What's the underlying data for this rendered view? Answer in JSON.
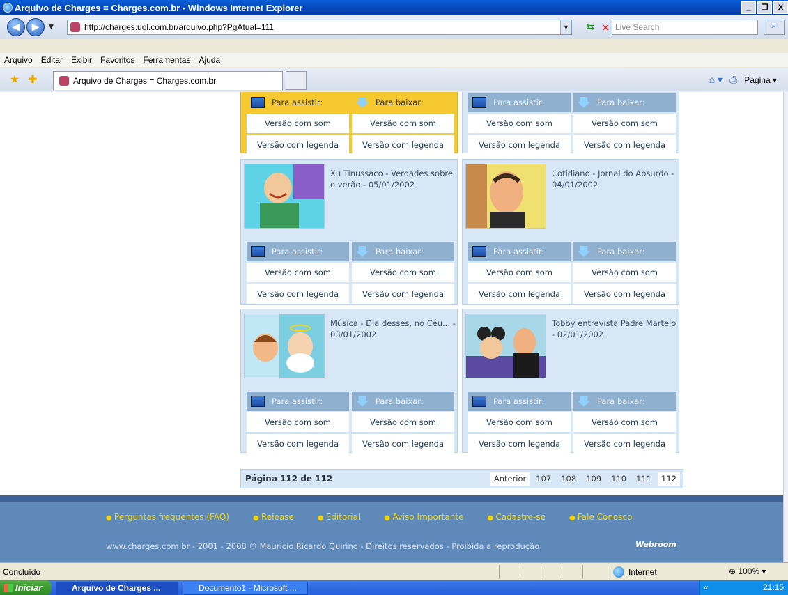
{
  "window": {
    "title": "Arquivo de Charges = Charges.com.br - Windows Internet Explorer",
    "controls": [
      "_",
      "❐",
      "X"
    ]
  },
  "nav": {
    "url": "http://charges.uol.com.br/arquivo.php?PgAtual=111",
    "search_placeholder": "Live Search"
  },
  "menu": [
    "Arquivo",
    "Editar",
    "Exibir",
    "Favoritos",
    "Ferramentas",
    "Ajuda"
  ],
  "tab": {
    "title": "Arquivo de Charges = Charges.com.br"
  },
  "cmdbar": {
    "page_label": "Página"
  },
  "labels": {
    "assistir": "Para assistir:",
    "baixar": "Para baixar:",
    "som": "Versão com som",
    "legenda": "Versão com legenda"
  },
  "cards": [
    {
      "title": "",
      "variant": "yellow"
    },
    {
      "title": "",
      "variant": "blue"
    },
    {
      "title": "Xu Tinussaco - Verdades sobre o verão - 05/01/2002",
      "variant": "blue"
    },
    {
      "title": "Cotidiano - Jornal do Absurdo - 04/01/2002",
      "variant": "blue"
    },
    {
      "title": "Música - Dia desses, no Céu... - 03/01/2002",
      "variant": "blue"
    },
    {
      "title": "Tobby entrevista Padre Martelo - 02/01/2002",
      "variant": "blue"
    }
  ],
  "pager": {
    "info": "Página 112 de 112",
    "anterior": "Anterior",
    "pages": [
      "107",
      "108",
      "109",
      "110",
      "111",
      "112"
    ],
    "current": "112"
  },
  "footer": {
    "links": [
      "Perguntas frequentes (FAQ)",
      "Release",
      "Editorial",
      "Aviso Importante",
      "Cadastre-se",
      "Fale Conosco"
    ],
    "copyright": "www.charges.com.br - 2001 - 2008 © Maurício Ricardo Quirino - Direitos reservados - Proibida a reprodução",
    "brand": "Webroom"
  },
  "status": {
    "text": "Concluído",
    "zone": "Internet",
    "zoom": "100%"
  },
  "taskbar": {
    "start": "Iniciar",
    "tasks": [
      "Arquivo de Charges ...",
      "Documento1 - Microsoft ..."
    ],
    "clock": "21:15"
  },
  "colors": {
    "accent_yellow": "#f7c930",
    "card_blue": "#d7e7f5",
    "footer_blue": "#5e89b8",
    "link_yellow": "#f3d500"
  }
}
